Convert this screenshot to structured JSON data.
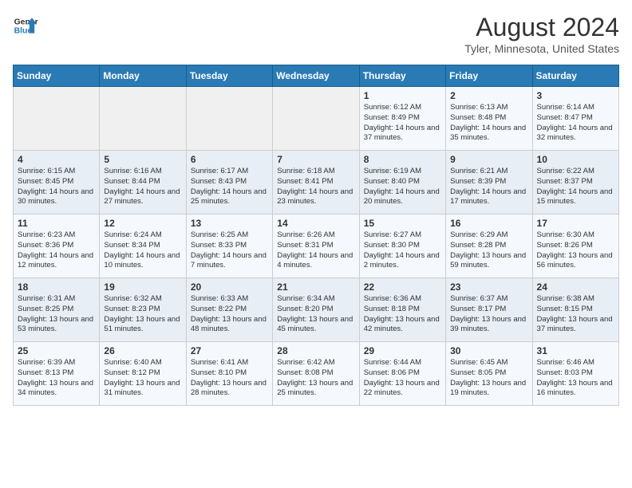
{
  "logo": {
    "line1": "General",
    "line2": "Blue"
  },
  "title": "August 2024",
  "location": "Tyler, Minnesota, United States",
  "days_header": [
    "Sunday",
    "Monday",
    "Tuesday",
    "Wednesday",
    "Thursday",
    "Friday",
    "Saturday"
  ],
  "weeks": [
    [
      {
        "num": "",
        "text": ""
      },
      {
        "num": "",
        "text": ""
      },
      {
        "num": "",
        "text": ""
      },
      {
        "num": "",
        "text": ""
      },
      {
        "num": "1",
        "text": "Sunrise: 6:12 AM\nSunset: 8:49 PM\nDaylight: 14 hours and 37 minutes."
      },
      {
        "num": "2",
        "text": "Sunrise: 6:13 AM\nSunset: 8:48 PM\nDaylight: 14 hours and 35 minutes."
      },
      {
        "num": "3",
        "text": "Sunrise: 6:14 AM\nSunset: 8:47 PM\nDaylight: 14 hours and 32 minutes."
      }
    ],
    [
      {
        "num": "4",
        "text": "Sunrise: 6:15 AM\nSunset: 8:45 PM\nDaylight: 14 hours and 30 minutes."
      },
      {
        "num": "5",
        "text": "Sunrise: 6:16 AM\nSunset: 8:44 PM\nDaylight: 14 hours and 27 minutes."
      },
      {
        "num": "6",
        "text": "Sunrise: 6:17 AM\nSunset: 8:43 PM\nDaylight: 14 hours and 25 minutes."
      },
      {
        "num": "7",
        "text": "Sunrise: 6:18 AM\nSunset: 8:41 PM\nDaylight: 14 hours and 23 minutes."
      },
      {
        "num": "8",
        "text": "Sunrise: 6:19 AM\nSunset: 8:40 PM\nDaylight: 14 hours and 20 minutes."
      },
      {
        "num": "9",
        "text": "Sunrise: 6:21 AM\nSunset: 8:39 PM\nDaylight: 14 hours and 17 minutes."
      },
      {
        "num": "10",
        "text": "Sunrise: 6:22 AM\nSunset: 8:37 PM\nDaylight: 14 hours and 15 minutes."
      }
    ],
    [
      {
        "num": "11",
        "text": "Sunrise: 6:23 AM\nSunset: 8:36 PM\nDaylight: 14 hours and 12 minutes."
      },
      {
        "num": "12",
        "text": "Sunrise: 6:24 AM\nSunset: 8:34 PM\nDaylight: 14 hours and 10 minutes."
      },
      {
        "num": "13",
        "text": "Sunrise: 6:25 AM\nSunset: 8:33 PM\nDaylight: 14 hours and 7 minutes."
      },
      {
        "num": "14",
        "text": "Sunrise: 6:26 AM\nSunset: 8:31 PM\nDaylight: 14 hours and 4 minutes."
      },
      {
        "num": "15",
        "text": "Sunrise: 6:27 AM\nSunset: 8:30 PM\nDaylight: 14 hours and 2 minutes."
      },
      {
        "num": "16",
        "text": "Sunrise: 6:29 AM\nSunset: 8:28 PM\nDaylight: 13 hours and 59 minutes."
      },
      {
        "num": "17",
        "text": "Sunrise: 6:30 AM\nSunset: 8:26 PM\nDaylight: 13 hours and 56 minutes."
      }
    ],
    [
      {
        "num": "18",
        "text": "Sunrise: 6:31 AM\nSunset: 8:25 PM\nDaylight: 13 hours and 53 minutes."
      },
      {
        "num": "19",
        "text": "Sunrise: 6:32 AM\nSunset: 8:23 PM\nDaylight: 13 hours and 51 minutes."
      },
      {
        "num": "20",
        "text": "Sunrise: 6:33 AM\nSunset: 8:22 PM\nDaylight: 13 hours and 48 minutes."
      },
      {
        "num": "21",
        "text": "Sunrise: 6:34 AM\nSunset: 8:20 PM\nDaylight: 13 hours and 45 minutes."
      },
      {
        "num": "22",
        "text": "Sunrise: 6:36 AM\nSunset: 8:18 PM\nDaylight: 13 hours and 42 minutes."
      },
      {
        "num": "23",
        "text": "Sunrise: 6:37 AM\nSunset: 8:17 PM\nDaylight: 13 hours and 39 minutes."
      },
      {
        "num": "24",
        "text": "Sunrise: 6:38 AM\nSunset: 8:15 PM\nDaylight: 13 hours and 37 minutes."
      }
    ],
    [
      {
        "num": "25",
        "text": "Sunrise: 6:39 AM\nSunset: 8:13 PM\nDaylight: 13 hours and 34 minutes."
      },
      {
        "num": "26",
        "text": "Sunrise: 6:40 AM\nSunset: 8:12 PM\nDaylight: 13 hours and 31 minutes."
      },
      {
        "num": "27",
        "text": "Sunrise: 6:41 AM\nSunset: 8:10 PM\nDaylight: 13 hours and 28 minutes."
      },
      {
        "num": "28",
        "text": "Sunrise: 6:42 AM\nSunset: 8:08 PM\nDaylight: 13 hours and 25 minutes."
      },
      {
        "num": "29",
        "text": "Sunrise: 6:44 AM\nSunset: 8:06 PM\nDaylight: 13 hours and 22 minutes."
      },
      {
        "num": "30",
        "text": "Sunrise: 6:45 AM\nSunset: 8:05 PM\nDaylight: 13 hours and 19 minutes."
      },
      {
        "num": "31",
        "text": "Sunrise: 6:46 AM\nSunset: 8:03 PM\nDaylight: 13 hours and 16 minutes."
      }
    ]
  ]
}
